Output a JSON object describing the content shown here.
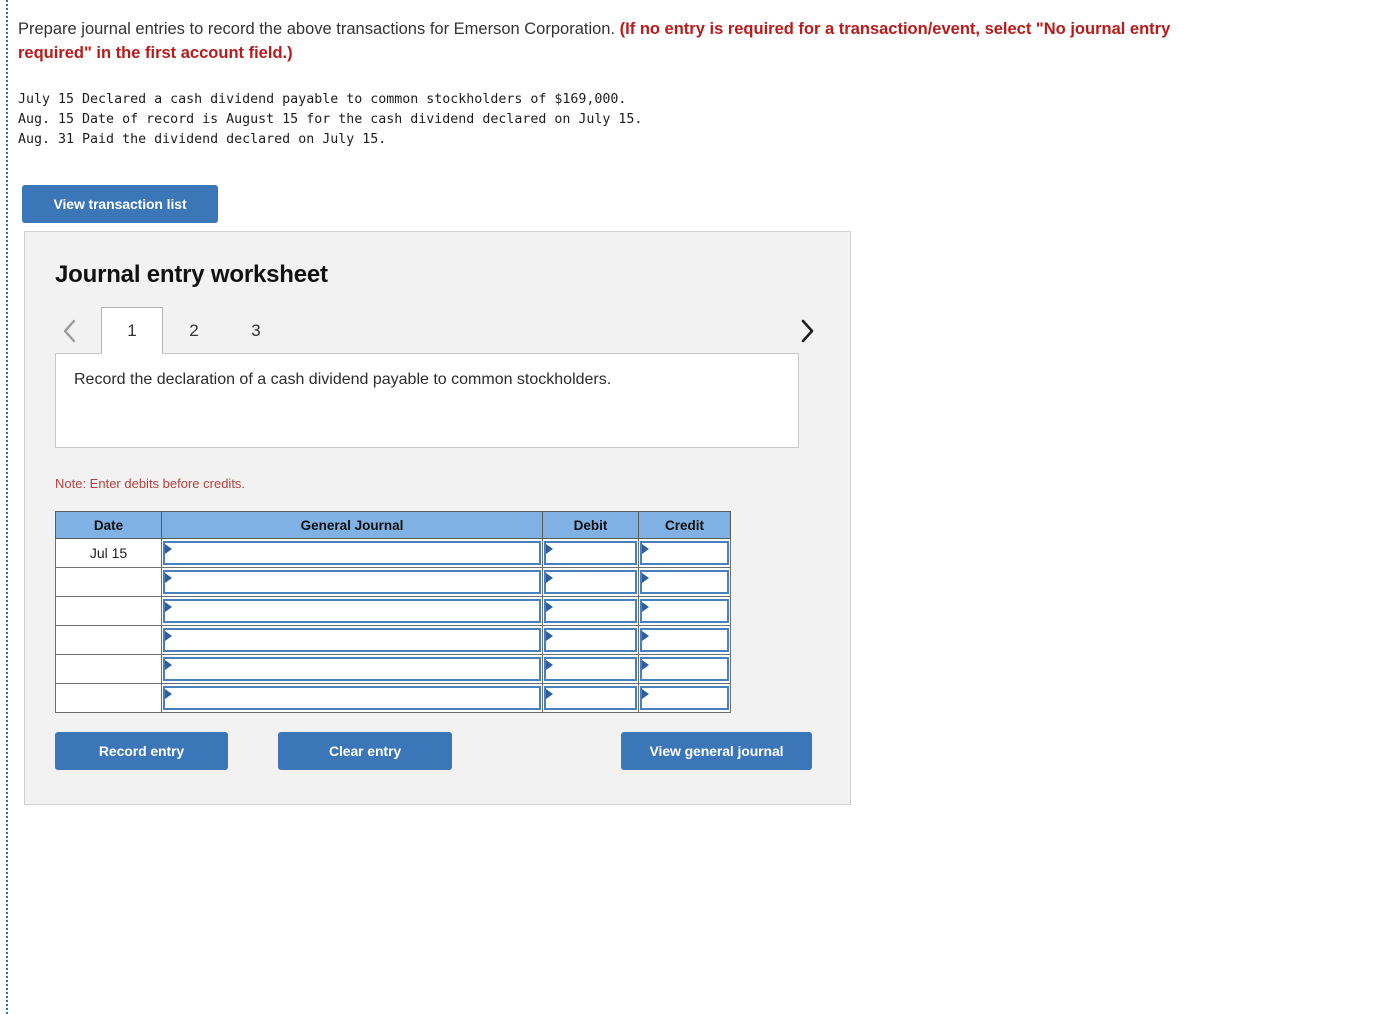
{
  "prompt": {
    "normal_text": "Prepare journal entries to record the above transactions for Emerson Corporation. ",
    "emphasis_text": "(If no entry is required for a transaction/event, select \"No journal entry required\" in the first account field.)"
  },
  "transactions": {
    "lines": [
      "July 15 Declared a cash dividend payable to common stockholders of $169,000.",
      "Aug. 15 Date of record is August 15 for the cash dividend declared on July 15.",
      "Aug. 31 Paid the dividend declared on July 15."
    ],
    "text": "July 15 Declared a cash dividend payable to common stockholders of $169,000.\nAug. 15 Date of record is August 15 for the cash dividend declared on July 15.\nAug. 31 Paid the dividend declared on July 15."
  },
  "buttons": {
    "view_transaction_list": "View transaction list",
    "record_entry": "Record entry",
    "clear_entry": "Clear entry",
    "view_general_journal": "View general journal"
  },
  "worksheet": {
    "title": "Journal entry worksheet",
    "tabs": [
      {
        "label": "1",
        "active": true
      },
      {
        "label": "2",
        "active": false
      },
      {
        "label": "3",
        "active": false
      }
    ],
    "nav": {
      "prev_icon": "chevron-left-icon",
      "next_icon": "chevron-right-icon",
      "prev_enabled": false,
      "next_enabled": true
    },
    "description": "Record the declaration of a cash dividend payable to common stockholders.",
    "note": "Note: Enter debits before credits.",
    "table": {
      "headers": [
        "Date",
        "General Journal",
        "Debit",
        "Credit"
      ],
      "rows": [
        {
          "date": "Jul 15",
          "general_journal": "",
          "debit": "",
          "credit": ""
        },
        {
          "date": "",
          "general_journal": "",
          "debit": "",
          "credit": ""
        },
        {
          "date": "",
          "general_journal": "",
          "debit": "",
          "credit": ""
        },
        {
          "date": "",
          "general_journal": "",
          "debit": "",
          "credit": ""
        },
        {
          "date": "",
          "general_journal": "",
          "debit": "",
          "credit": ""
        },
        {
          "date": "",
          "general_journal": "",
          "debit": "",
          "credit": ""
        }
      ]
    }
  },
  "colors": {
    "accent_blue": "#3a76b8",
    "table_header_blue": "#7fb1e4",
    "field_border_blue": "#4a7fbd",
    "alert_red": "#b51c1c",
    "note_red": "#b2423f",
    "panel_bg": "#f2f2f2"
  }
}
